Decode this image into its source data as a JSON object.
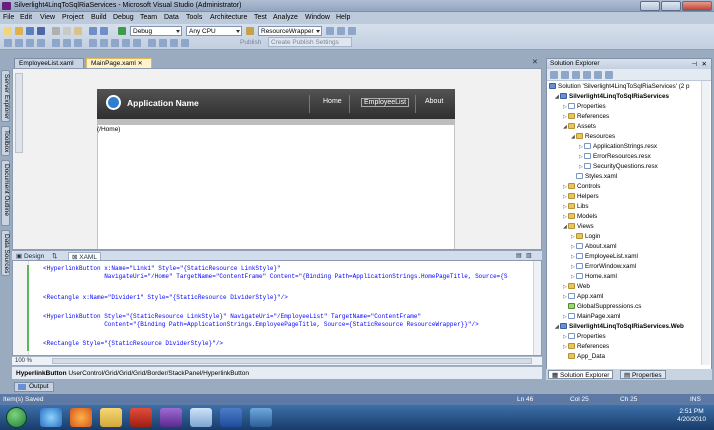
{
  "window": {
    "title": "Silverlight4LinqToSqlRiaServices - Microsoft Visual Studio (Administrator)"
  },
  "menu": [
    "File",
    "Edit",
    "View",
    "Project",
    "Build",
    "Debug",
    "Team",
    "Data",
    "Tools",
    "Architecture",
    "Test",
    "Analyze",
    "Window",
    "Help"
  ],
  "toolbar": {
    "config": "Debug",
    "platform": "Any CPU",
    "find": "ResourceWrapper",
    "publish": "Publish",
    "publish_settings": "Create Publish Settings"
  },
  "side_tabs": [
    "Server Explorer",
    "Toolbox",
    "Document Outline",
    "Data Sources"
  ],
  "doc_tabs": [
    "EmployeeList.xaml",
    "MainPage.xaml"
  ],
  "designer": {
    "app_name": "Application Name",
    "nav": [
      "Home",
      "EmployeeList",
      "About"
    ],
    "route": "(/Home)"
  },
  "split": {
    "design": "Design",
    "swap": "⇅",
    "xaml": "XAML"
  },
  "code_lines": [
    "<HyperlinkButton x:Name=\"Link1\" Style=\"{StaticResource LinkStyle}\"",
    "                 NavigateUri=\"/Home\" TargetName=\"ContentFrame\" Content=\"{Binding Path=ApplicationStrings.HomePageTitle, Source={S",
    "",
    "<Rectangle x:Name=\"Divider1\" Style=\"{StaticResource DividerStyle}\"/>",
    "",
    "<HyperlinkButton Style=\"{StaticResource LinkStyle}\" NavigateUri=\"/EmployeeList\" TargetName=\"ContentFrame\"",
    "                 Content=\"{Binding Path=ApplicationStrings.EmployeePageTitle, Source={StaticResource ResourceWrapper}}\"/>",
    "",
    "<Rectangle Style=\"{StaticResource DividerStyle}\"/>"
  ],
  "zoom": "100 %",
  "breadcrumb": {
    "first": "HyperlinkButton",
    "rest": "UserControl/Grid/Grid/Grid/Border/StackPanel/HyperlinkButton"
  },
  "output_tab": "Output",
  "status": {
    "left": "Item(s) Saved",
    "ln": "Ln 46",
    "col": "Col 25",
    "ch": "Ch 25",
    "ins": "INS"
  },
  "solution_explorer": {
    "title": "Solution Explorer",
    "items": [
      {
        "label": "Solution 'Silverlight4LinqToSqlRiaServices' (2 p",
        "indent": 0,
        "icon": "solution"
      },
      {
        "label": "Silverlight4LinqToSqlRiaServices",
        "indent": 1,
        "icon": "project",
        "bold": true
      },
      {
        "label": "Properties",
        "indent": 2,
        "icon": "file"
      },
      {
        "label": "References",
        "indent": 2,
        "icon": "folder"
      },
      {
        "label": "Assets",
        "indent": 2,
        "icon": "folder"
      },
      {
        "label": "Resources",
        "indent": 3,
        "icon": "folder"
      },
      {
        "label": "ApplicationStrings.resx",
        "indent": 4,
        "icon": "file"
      },
      {
        "label": "ErrorResources.resx",
        "indent": 4,
        "icon": "file"
      },
      {
        "label": "SecurityQuestions.resx",
        "indent": 4,
        "icon": "file"
      },
      {
        "label": "Styles.xaml",
        "indent": 3,
        "icon": "file"
      },
      {
        "label": "Controls",
        "indent": 2,
        "icon": "folder"
      },
      {
        "label": "Helpers",
        "indent": 2,
        "icon": "folder"
      },
      {
        "label": "Libs",
        "indent": 2,
        "icon": "folder"
      },
      {
        "label": "Models",
        "indent": 2,
        "icon": "folder"
      },
      {
        "label": "Views",
        "indent": 2,
        "icon": "folder"
      },
      {
        "label": "Login",
        "indent": 3,
        "icon": "folder"
      },
      {
        "label": "About.xaml",
        "indent": 3,
        "icon": "file"
      },
      {
        "label": "EmployeeList.xaml",
        "indent": 3,
        "icon": "file"
      },
      {
        "label": "ErrorWindow.xaml",
        "indent": 3,
        "icon": "file"
      },
      {
        "label": "Home.xaml",
        "indent": 3,
        "icon": "file"
      },
      {
        "label": "Web",
        "indent": 2,
        "icon": "folder"
      },
      {
        "label": "App.xaml",
        "indent": 2,
        "icon": "file"
      },
      {
        "label": "GlobalSuppressions.cs",
        "indent": 2,
        "icon": "cs"
      },
      {
        "label": "MainPage.xaml",
        "indent": 2,
        "icon": "file"
      },
      {
        "label": "Silverlight4LinqToSqlRiaServices.Web",
        "indent": 1,
        "icon": "project",
        "bold": true
      },
      {
        "label": "Properties",
        "indent": 2,
        "icon": "file"
      },
      {
        "label": "References",
        "indent": 2,
        "icon": "folder"
      },
      {
        "label": "App_Data",
        "indent": 2,
        "icon": "folder"
      }
    ],
    "tabs": [
      "Solution Explorer",
      "Properties"
    ]
  },
  "clock": {
    "time": "2:51 PM",
    "date": "4/20/2010"
  }
}
